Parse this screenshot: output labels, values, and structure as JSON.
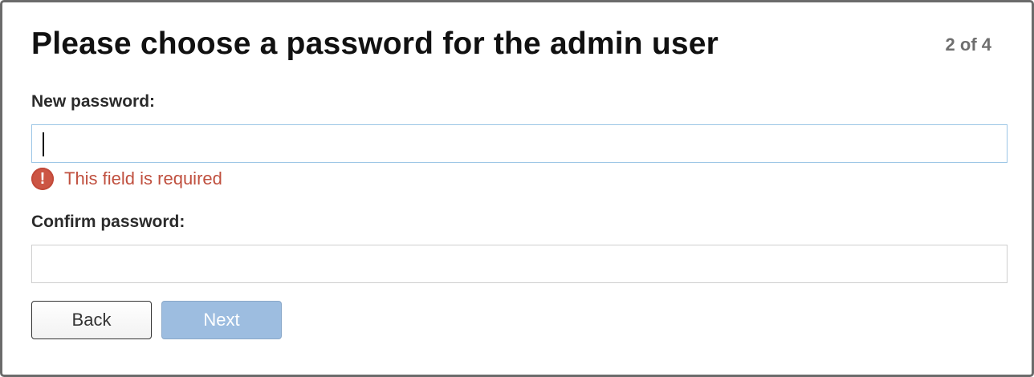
{
  "dialog": {
    "title": "Please choose a password for the admin user",
    "step": "2 of 4"
  },
  "form": {
    "new_password_label": "New password:",
    "new_password_value": "",
    "error_icon": "alert-circle-icon",
    "error_icon_glyph": "!",
    "error_message": "This field is required",
    "confirm_password_label": "Confirm password:",
    "confirm_password_value": ""
  },
  "buttons": {
    "back_label": "Back",
    "next_label": "Next"
  },
  "colors": {
    "error": "#c0503f",
    "focus_border": "#9cc6e6",
    "next_disabled_bg": "#9dbde0"
  }
}
